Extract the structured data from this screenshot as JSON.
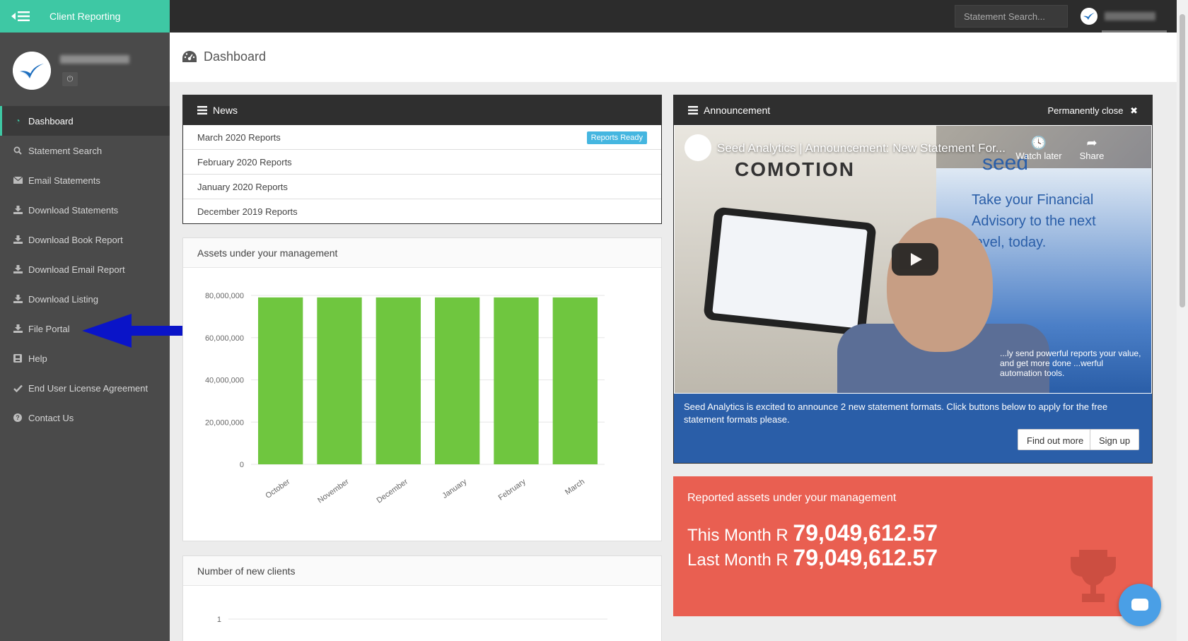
{
  "app": {
    "title": "Client Reporting"
  },
  "topbar": {
    "search_placeholder": "Statement Search..."
  },
  "sidebar": {
    "items": [
      {
        "label": "Dashboard",
        "icon": "dashboard-icon",
        "active": true
      },
      {
        "label": "Statement Search",
        "icon": "search-icon"
      },
      {
        "label": "Email Statements",
        "icon": "envelope-icon"
      },
      {
        "label": "Download Statements",
        "icon": "download-icon"
      },
      {
        "label": "Download Book Report",
        "icon": "download-icon"
      },
      {
        "label": "Download Email Report",
        "icon": "download-icon"
      },
      {
        "label": "Download Listing",
        "icon": "download-icon"
      },
      {
        "label": "File Portal",
        "icon": "download-icon"
      },
      {
        "label": "Help",
        "icon": "help-book-icon"
      },
      {
        "label": "End User License Agreement",
        "icon": "check-icon"
      },
      {
        "label": "Contact Us",
        "icon": "question-icon"
      }
    ]
  },
  "page": {
    "title": "Dashboard"
  },
  "news": {
    "title": "News",
    "rows": [
      {
        "label": "March 2020 Reports",
        "badge": "Reports Ready"
      },
      {
        "label": "February 2020 Reports"
      },
      {
        "label": "January 2020 Reports"
      },
      {
        "label": "December 2019 Reports"
      }
    ]
  },
  "assets_panel": {
    "title": "Assets under your management"
  },
  "clients_panel": {
    "title": "Number of new clients",
    "first_tick": "1"
  },
  "announcement": {
    "title": "Announcement",
    "close_label": "Permanently close",
    "video_title": "Seed Analytics | Announcement: New Statement For...",
    "watch_later": "Watch later",
    "share": "Share",
    "body": "Seed Analytics is excited to announce 2 new statement formats. Click buttons below to apply for the free statement formats please.",
    "find_out_more": "Find out more",
    "sign_up": "Sign up"
  },
  "report": {
    "title": "Reported assets under your management",
    "this_month_label": "This Month R",
    "this_month_value": "79,049,612.57",
    "last_month_label": "Last Month R",
    "last_month_value": "79,049,612.57"
  },
  "colors": {
    "brand": "#3ec8a4",
    "bar": "#6fc63f",
    "report_bg": "#e95f51",
    "announce_blue": "#2a5ea8",
    "badge": "#45b6e0",
    "arrow": "#0a14c8"
  },
  "chart_data": {
    "type": "bar",
    "categories": [
      "October",
      "November",
      "December",
      "January",
      "February",
      "March"
    ],
    "values": [
      79049612.57,
      79049612.57,
      79049612.57,
      79049612.57,
      79049612.57,
      79049612.57
    ],
    "yticks": [
      "80,000,000",
      "60,000,000",
      "40,000,000",
      "20,000,000",
      "0"
    ],
    "ylim": [
      0,
      80000000
    ],
    "title": "Assets under your management",
    "xlabel": "",
    "ylabel": "",
    "grid": true
  }
}
